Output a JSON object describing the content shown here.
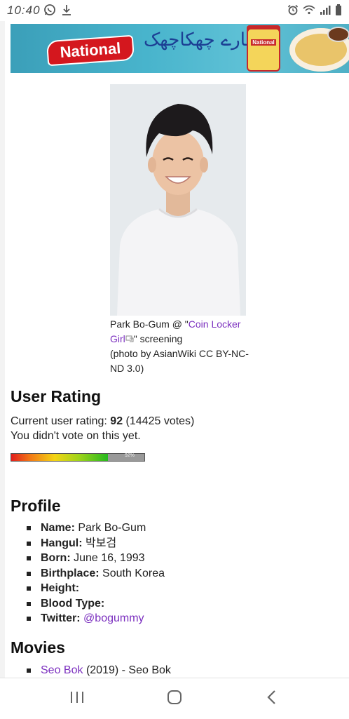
{
  "status_bar": {
    "time": "10:40",
    "icons": [
      "whatsapp-icon",
      "download-icon",
      "alarm-icon",
      "wifi-icon",
      "signal-icon",
      "battery-icon"
    ]
  },
  "banner": {
    "brand": "National",
    "urdu_tagline": "چٹخارے چھکاچھک",
    "jar_label": "National"
  },
  "photo": {
    "caption_prefix": "Park Bo-Gum @ \"",
    "caption_link": "Coin Locker Girl",
    "caption_suffix": "\" screening",
    "caption_credit": "(photo by AsianWiki CC BY-NC-ND 3.0)"
  },
  "user_rating": {
    "title": "User Rating",
    "label": "Current user rating:",
    "value": "92",
    "votes": "(14425 votes)",
    "vote_status": "You didn't vote on this yet.",
    "bar_percent": 92,
    "bar_label": "92%"
  },
  "profile": {
    "title": "Profile",
    "items": [
      {
        "label": "Name:",
        "value": "Park Bo-Gum"
      },
      {
        "label": "Hangul:",
        "value": "박보검"
      },
      {
        "label": "Born:",
        "value": "June 16, 1993"
      },
      {
        "label": "Birthplace:",
        "value": "South Korea"
      },
      {
        "label": "Height:",
        "value": ""
      },
      {
        "label": "Blood Type:",
        "value": ""
      },
      {
        "label": "Twitter:",
        "value": "@bogummy"
      }
    ]
  },
  "movies": {
    "title": "Movies",
    "items": [
      {
        "title": "Seo Bok",
        "year": "(2019)",
        "role": "- Seo Bok"
      }
    ]
  },
  "colors": {
    "link": "#7b2fbf",
    "banner_bg": "#48b4cc",
    "brand_red": "#d4171e"
  },
  "nav_bar": {
    "buttons": [
      "recent-apps-icon",
      "home-icon",
      "back-icon"
    ]
  }
}
